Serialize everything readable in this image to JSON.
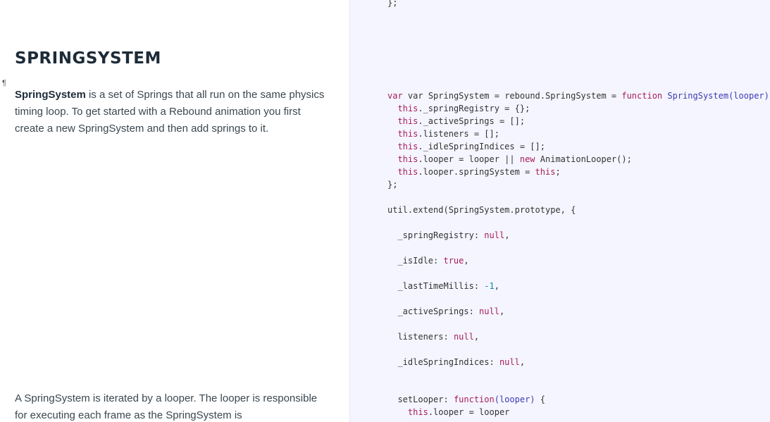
{
  "docs": {
    "section_title": "SPRINGSYSTEM",
    "pilcrow": "¶",
    "para1_strong": "SpringSystem",
    "para1_rest": " is a set of Springs that all run on the same physics timing loop. To get started with a Rebound animation you first create a new SpringSystem and then add springs to it.",
    "para2": "A SpringSystem is iterated by a looper. The looper is responsible for executing each frame as the SpringSystem is"
  },
  "code": {
    "top_fragment": "};",
    "ctor_decl": "var SpringSystem = rebound.SpringSystem = ",
    "ctor_function_kw": "function",
    "ctor_name": " SpringSystem(looper)",
    "ctor_open": " {",
    "this_kw": "this",
    "line_registry": "._springRegistry = {};",
    "line_active": "._activeSprings = [];",
    "line_listeners": ".listeners = [];",
    "line_idle": "._idleSpringIndices = [];",
    "line_looper_a": ".looper = looper || ",
    "new_kw": "new",
    "line_looper_b": " AnimationLooper();",
    "line_springsystem": ".looper.springSystem = ",
    "line_semicolon": ";",
    "ctor_close": "};",
    "extend_line": "util.extend(SpringSystem.prototype, {",
    "prop_registry": "_springRegistry: ",
    "prop_isidle": "_isIdle: ",
    "prop_lasttime": "_lastTimeMillis: ",
    "prop_activesprings": "_activeSprings: ",
    "prop_listeners": "listeners: ",
    "prop_idleindices": "_idleSpringIndices: ",
    "null_lit": "null",
    "true_lit": "true",
    "minus_one": "-1",
    "comma": ",",
    "setlooper_name": "setLooper: ",
    "setlooper_fn": "function",
    "setlooper_args": "(looper)",
    "setlooper_open": " {",
    "setlooper_body": ".looper = looper"
  }
}
